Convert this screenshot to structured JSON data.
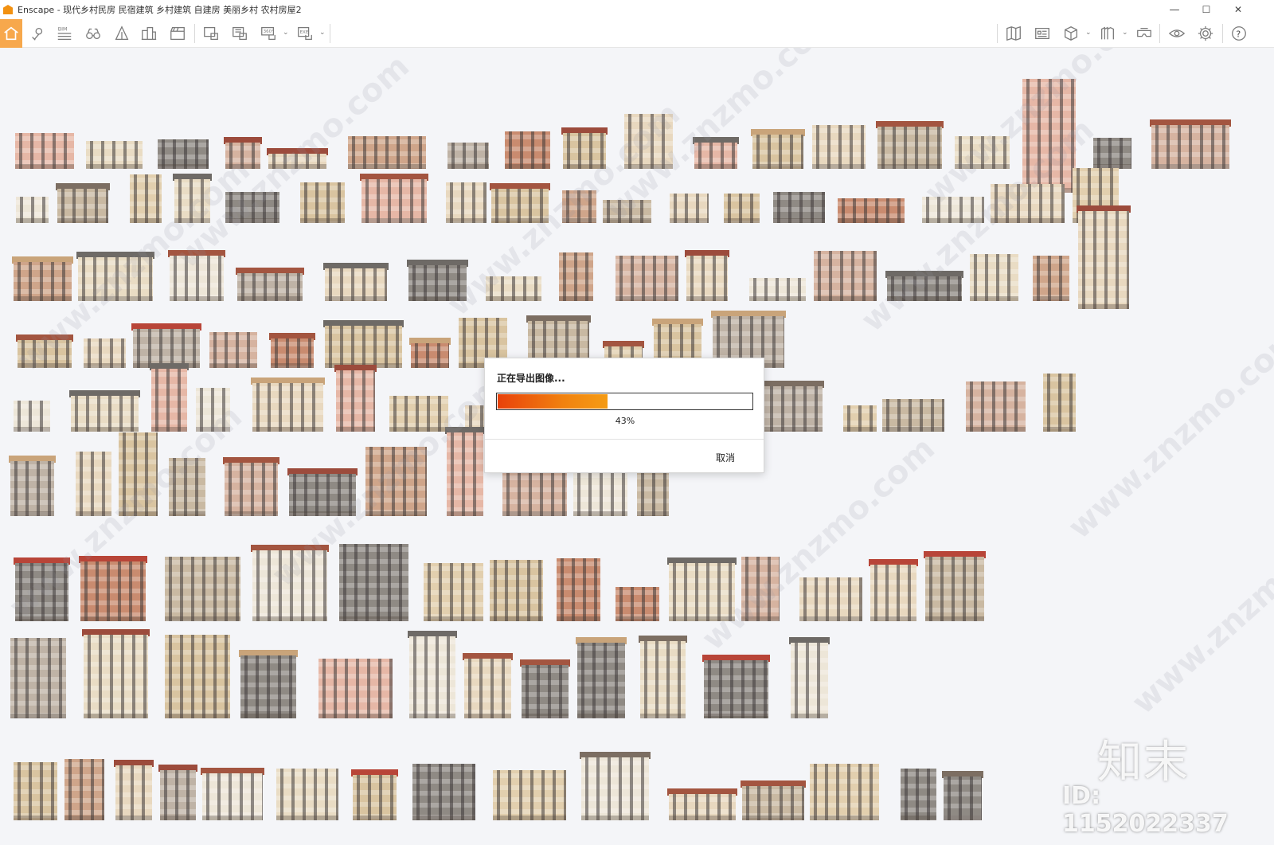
{
  "window": {
    "title": "Enscape - 现代乡村民房 民宿建筑 乡村建筑 自建房 美丽乡村 农村房屋2",
    "minimize": "—",
    "maximize": "☐",
    "close": "✕"
  },
  "toolbar": {
    "left_icons": [
      "home-icon",
      "map-pin-icon",
      "bim-icon",
      "binoculars-icon",
      "sky-icon",
      "buildings-icon",
      "clapper-icon",
      "screenshot-icon",
      "batch-render-icon",
      "panorama-360-icon",
      "export-exe-icon"
    ],
    "bim_label": "BIM",
    "pano_label": "360°",
    "exe_label": "EXE",
    "right_icons": [
      "book-icon",
      "asset-library-icon",
      "cube-icon",
      "material-icon",
      "vr-headset-icon",
      "eye-icon",
      "settings-icon",
      "help-icon"
    ],
    "help_label": "?"
  },
  "dialog": {
    "title": "正在导出图像...",
    "progress": 0.43,
    "progress_text": "43%",
    "cancel_label": "取消",
    "accent_start": "#e8410b",
    "accent_end": "#f59c14"
  },
  "watermark": {
    "text": "www.znzmo.com",
    "logo": "知末",
    "id": "ID: 1152022337"
  },
  "colors": {
    "home_active": "#f7a84c",
    "viewport_bg": "#f4f5f8"
  }
}
